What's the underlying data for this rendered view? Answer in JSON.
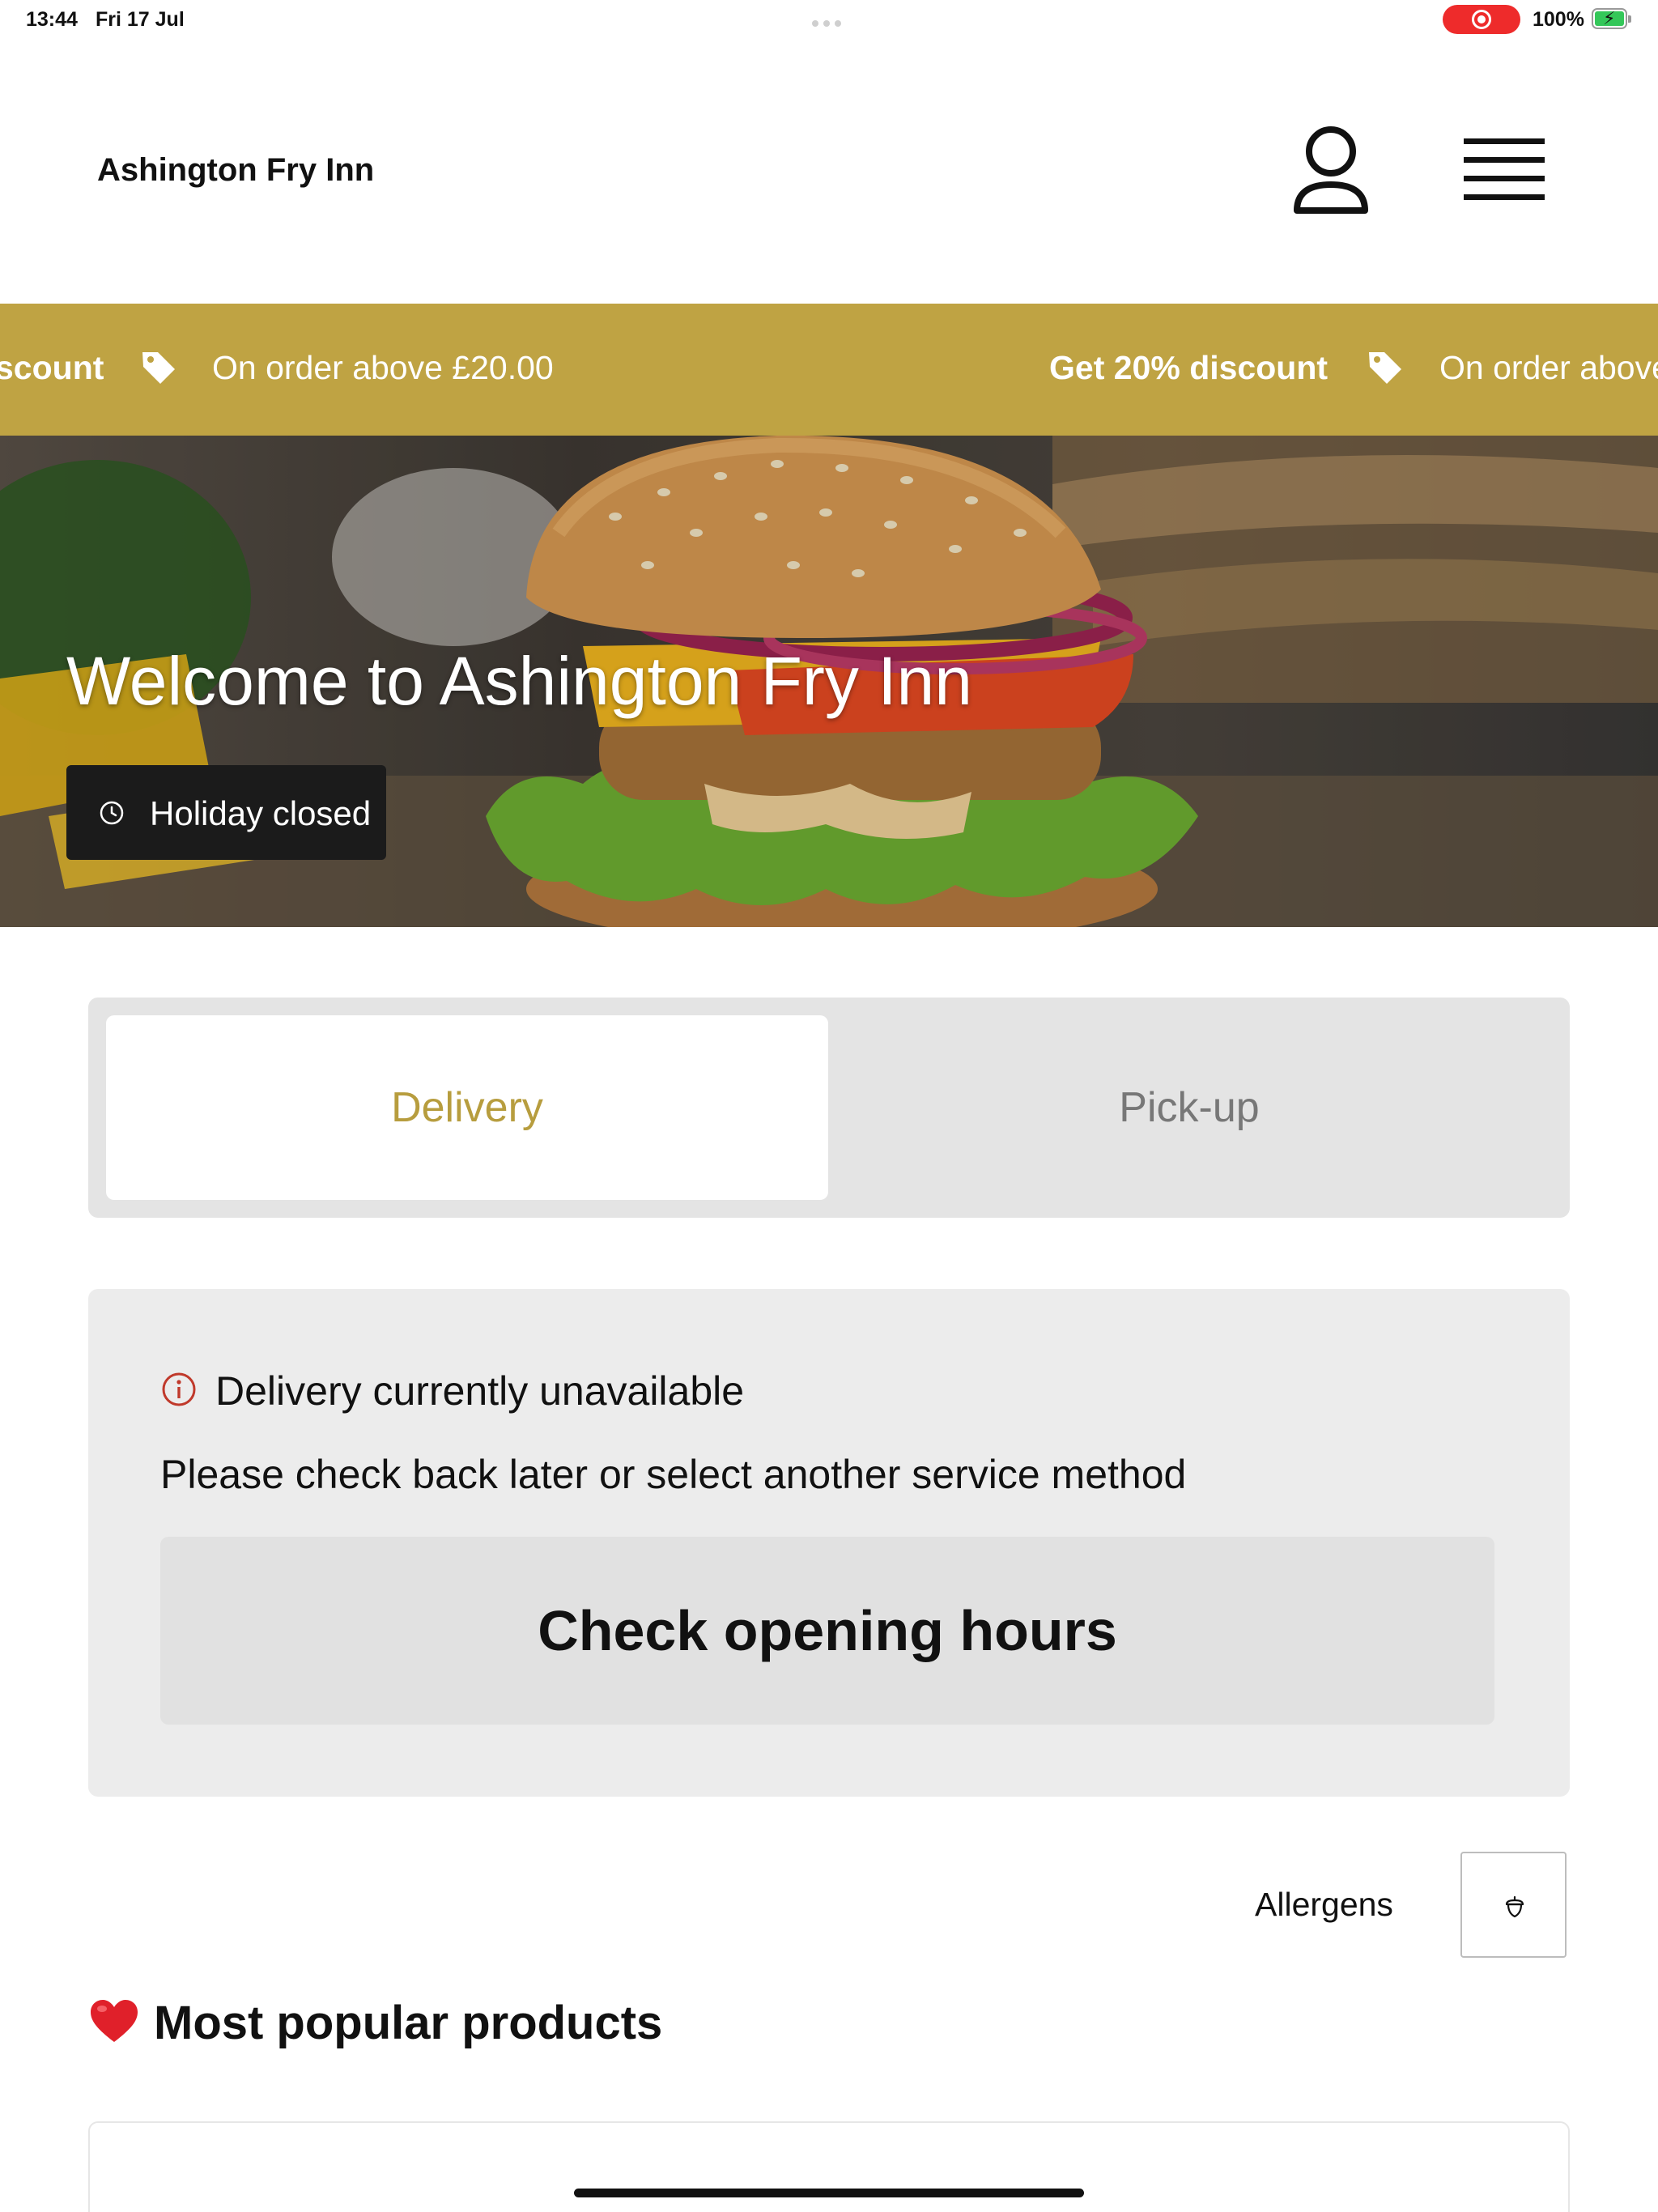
{
  "status_bar": {
    "time": "13:44",
    "date": "Fri 17 Jul",
    "battery": "100%",
    "recording_color": "#ee2b2b"
  },
  "header": {
    "title": "Ashington Fry Inn",
    "account_icon": "user-icon",
    "menu_icon": "hamburger-menu-icon"
  },
  "promo": {
    "background": "#bfa343",
    "items": [
      {
        "bold": "Get 20% discount",
        "text": "On order above £20.00"
      },
      {
        "bold": "Get 20% discount",
        "text": "On order above £20.00"
      }
    ],
    "fragment_left": "scount",
    "fragment_right": "On order above",
    "icon": "tag-icon"
  },
  "hero": {
    "title": "Welcome to Ashington Fry Inn",
    "status_label": "Holiday closed",
    "status_icon": "clock-icon"
  },
  "service_tabs": {
    "delivery": "Delivery",
    "pickup": "Pick-up",
    "selected": "Delivery",
    "accent_color": "#b79d3e"
  },
  "notice": {
    "title": "Delivery currently unavailable",
    "text": "Please check back later or select another service method",
    "button": "Check opening hours",
    "icon": "info-icon"
  },
  "allergens": {
    "label": "Allergens",
    "icon": "acorn-icon"
  },
  "popular": {
    "heading": "Most popular products",
    "icon": "heart-icon"
  }
}
